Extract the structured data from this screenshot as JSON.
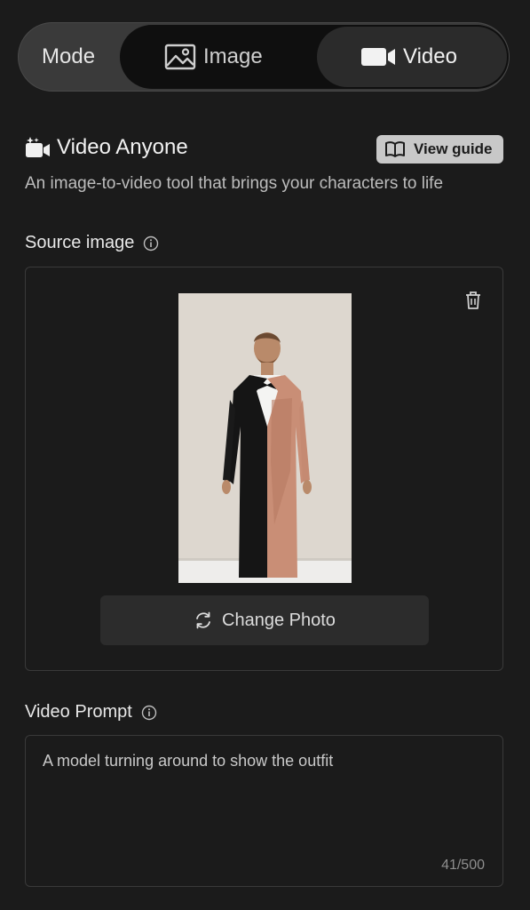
{
  "mode": {
    "label": "Mode",
    "options": [
      {
        "label": "Image",
        "icon": "image-icon"
      },
      {
        "label": "Video",
        "icon": "video-camera-icon"
      }
    ],
    "selected": "Video"
  },
  "header": {
    "title": "Video Anyone",
    "guide_button": "View guide",
    "description": "An image-to-video tool that brings your characters to life"
  },
  "source_image": {
    "label": "Source image",
    "change_button": "Change Photo"
  },
  "prompt": {
    "label": "Video Prompt",
    "value": "A model turning around to show the outfit",
    "counter": "41/500"
  },
  "colors": {
    "background": "#1b1b1b",
    "selected_tab": "#2b2b2b",
    "guide_button": "#c8c8c8"
  }
}
